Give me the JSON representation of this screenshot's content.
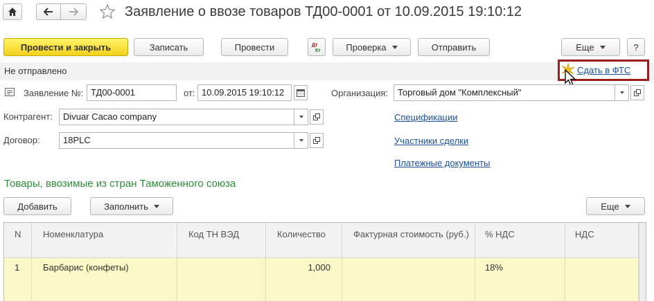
{
  "title": "Заявление о ввозе товаров ТД00-0001 от 10.09.2015 19:10:12",
  "toolbar": {
    "post_close": "Провести и закрыть",
    "save": "Записать",
    "post": "Провести",
    "check": "Проверка",
    "send": "Отправить",
    "more": "Еще",
    "help": "?"
  },
  "status": "Не отправлено",
  "fts_link": "Сдать в ФТС",
  "form": {
    "statement_label": "Заявление №:",
    "statement_value": "ТД00-0001",
    "date_label": "от:",
    "date_value": "10.09.2015 19:10:12",
    "org_label": "Организация:",
    "org_value": "Торговый дом \"Комплексный\"",
    "contractor_label": "Контрагент:",
    "contractor_value": "Divuar Cacao company",
    "contract_label": "Договор:",
    "contract_value": "18PLC"
  },
  "links": {
    "specs": "Спецификации",
    "participants": "Участники сделки",
    "payments": "Платежные документы"
  },
  "section_title": "Товары, ввозимые из стран Таможенного союза",
  "table_toolbar": {
    "add": "Добавить",
    "fill": "Заполнить",
    "more": "Еще"
  },
  "table": {
    "columns": [
      "N",
      "Номенклатура",
      "Код ТН ВЭД",
      "Количество",
      "Фактурная стоимость (руб.)",
      "% НДС",
      "НДС"
    ],
    "rows": [
      {
        "n": "1",
        "item": "Барбарис (конфеты)",
        "code": "",
        "qty": "1,000",
        "cost": "",
        "vat_rate": "18%",
        "vat": ""
      }
    ]
  },
  "colors": {
    "primary_button": "#f2d11a",
    "section_title": "#2e8b3a",
    "link": "#1a4f9c",
    "row_highlight": "#fbf8c8",
    "callout_border": "#9b1c1c"
  }
}
